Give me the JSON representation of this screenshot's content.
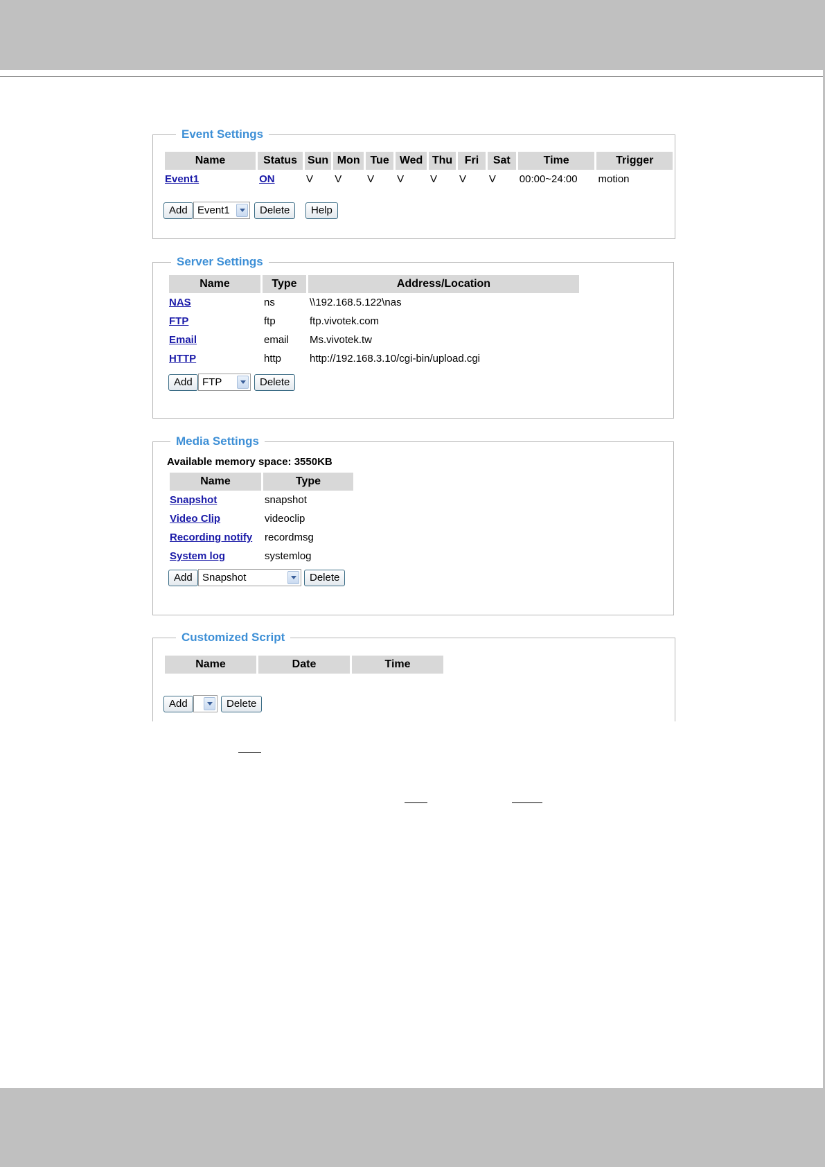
{
  "event": {
    "legend": "Event Settings",
    "headers": [
      "Name",
      "Status",
      "Sun",
      "Mon",
      "Tue",
      "Wed",
      "Thu",
      "Fri",
      "Sat",
      "Time",
      "Trigger"
    ],
    "row": {
      "name": "Event1",
      "status": "ON",
      "days": [
        "V",
        "V",
        "V",
        "V",
        "V",
        "V",
        "V"
      ],
      "time": "00:00~24:00",
      "trigger": "motion"
    },
    "add_label": "Add",
    "select_value": "Event1",
    "delete_label": "Delete",
    "help_label": "Help"
  },
  "server": {
    "legend": "Server Settings",
    "headers": [
      "Name",
      "Type",
      "Address/Location"
    ],
    "rows": [
      {
        "name": "NAS",
        "type": "ns",
        "address": "\\\\192.168.5.122\\nas"
      },
      {
        "name": "FTP",
        "type": "ftp",
        "address": "ftp.vivotek.com"
      },
      {
        "name": "Email",
        "type": "email",
        "address": "Ms.vivotek.tw"
      },
      {
        "name": "HTTP",
        "type": "http",
        "address": "http://192.168.3.10/cgi-bin/upload.cgi"
      }
    ],
    "add_label": "Add",
    "select_value": "FTP",
    "delete_label": "Delete"
  },
  "media": {
    "legend": "Media Settings",
    "memory_text": "Available memory space: 3550KB",
    "headers": [
      "Name",
      "Type"
    ],
    "rows": [
      {
        "name": "Snapshot",
        "type": "snapshot"
      },
      {
        "name": "Video Clip",
        "type": "videoclip"
      },
      {
        "name": "Recording notify",
        "type": "recordmsg"
      },
      {
        "name": "System log",
        "type": "systemlog"
      }
    ],
    "add_label": "Add",
    "select_value": "Snapshot",
    "delete_label": "Delete"
  },
  "script": {
    "legend": "Customized Script",
    "headers": [
      "Name",
      "Date",
      "Time"
    ],
    "add_label": "Add",
    "select_value": "",
    "delete_label": "Delete"
  }
}
